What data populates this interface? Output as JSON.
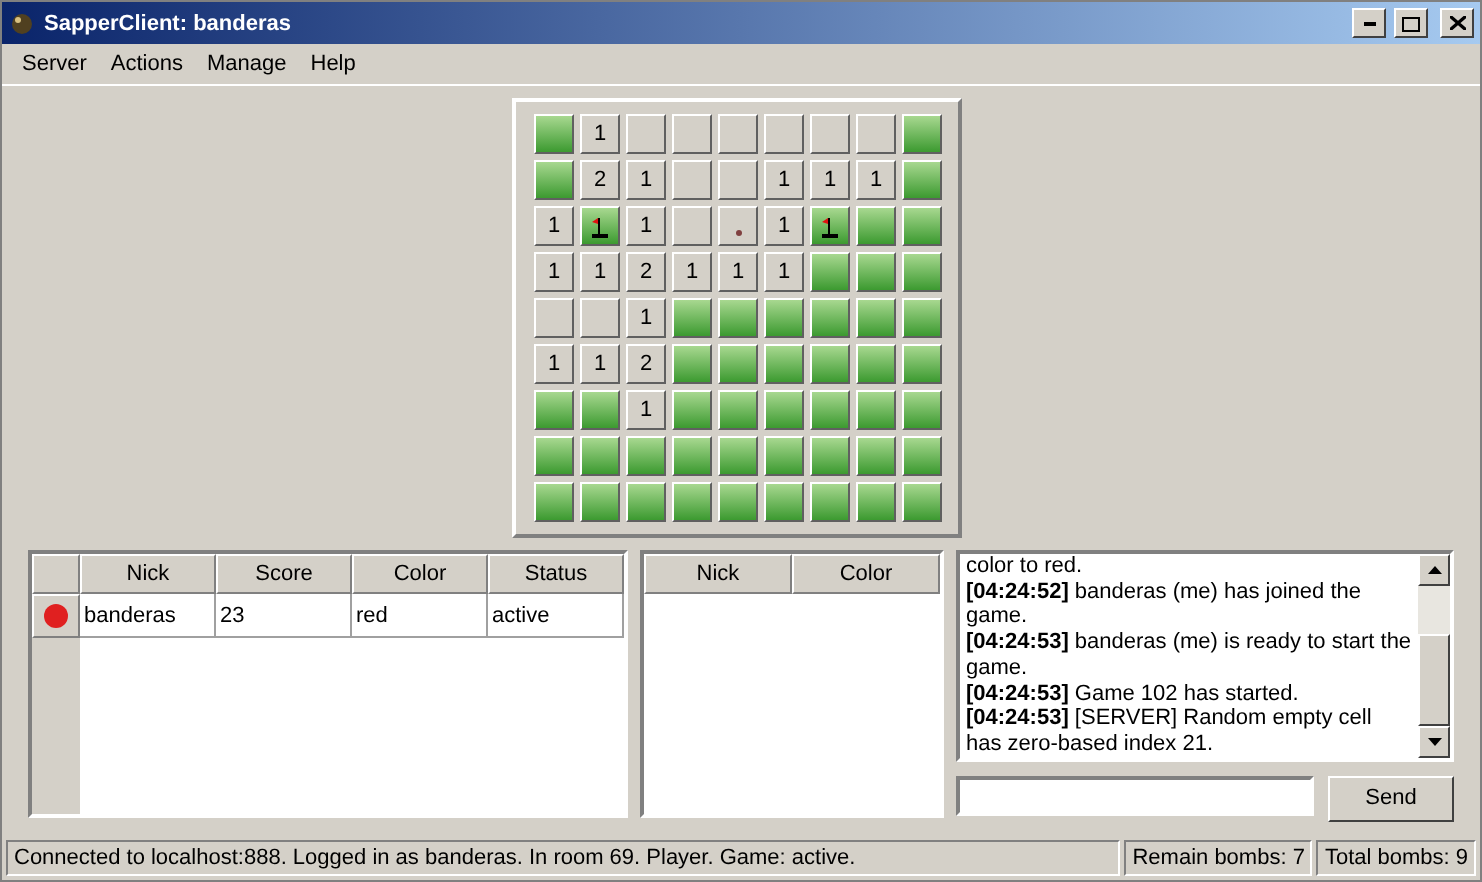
{
  "window": {
    "title": "SapperClient: banderas"
  },
  "menu": [
    "Server",
    "Actions",
    "Manage",
    "Help"
  ],
  "board": [
    [
      {
        "kind": "closed"
      },
      {
        "kind": "open",
        "text": "1"
      },
      {
        "kind": "open"
      },
      {
        "kind": "open"
      },
      {
        "kind": "open"
      },
      {
        "kind": "open"
      },
      {
        "kind": "open"
      },
      {
        "kind": "open"
      },
      {
        "kind": "closed"
      }
    ],
    [
      {
        "kind": "closed"
      },
      {
        "kind": "open",
        "text": "2"
      },
      {
        "kind": "open",
        "text": "1"
      },
      {
        "kind": "open"
      },
      {
        "kind": "open"
      },
      {
        "kind": "open",
        "text": "1"
      },
      {
        "kind": "open",
        "text": "1"
      },
      {
        "kind": "open",
        "text": "1"
      },
      {
        "kind": "closed"
      }
    ],
    [
      {
        "kind": "open",
        "text": "1"
      },
      {
        "kind": "flag"
      },
      {
        "kind": "open",
        "text": "1"
      },
      {
        "kind": "open"
      },
      {
        "kind": "dot"
      },
      {
        "kind": "open",
        "text": "1"
      },
      {
        "kind": "flag"
      },
      {
        "kind": "closed"
      },
      {
        "kind": "closed"
      }
    ],
    [
      {
        "kind": "open",
        "text": "1"
      },
      {
        "kind": "open",
        "text": "1"
      },
      {
        "kind": "open",
        "text": "2"
      },
      {
        "kind": "open",
        "text": "1"
      },
      {
        "kind": "open",
        "text": "1"
      },
      {
        "kind": "open",
        "text": "1"
      },
      {
        "kind": "closed"
      },
      {
        "kind": "closed"
      },
      {
        "kind": "closed"
      }
    ],
    [
      {
        "kind": "open"
      },
      {
        "kind": "open"
      },
      {
        "kind": "open",
        "text": "1"
      },
      {
        "kind": "closed"
      },
      {
        "kind": "closed"
      },
      {
        "kind": "closed"
      },
      {
        "kind": "closed"
      },
      {
        "kind": "closed"
      },
      {
        "kind": "closed"
      }
    ],
    [
      {
        "kind": "open",
        "text": "1"
      },
      {
        "kind": "open",
        "text": "1"
      },
      {
        "kind": "open",
        "text": "2"
      },
      {
        "kind": "closed"
      },
      {
        "kind": "closed"
      },
      {
        "kind": "closed"
      },
      {
        "kind": "closed"
      },
      {
        "kind": "closed"
      },
      {
        "kind": "closed"
      }
    ],
    [
      {
        "kind": "closed"
      },
      {
        "kind": "closed"
      },
      {
        "kind": "open",
        "text": "1"
      },
      {
        "kind": "closed"
      },
      {
        "kind": "closed"
      },
      {
        "kind": "closed"
      },
      {
        "kind": "closed"
      },
      {
        "kind": "closed"
      },
      {
        "kind": "closed"
      }
    ],
    [
      {
        "kind": "closed"
      },
      {
        "kind": "closed"
      },
      {
        "kind": "closed"
      },
      {
        "kind": "closed"
      },
      {
        "kind": "closed"
      },
      {
        "kind": "closed"
      },
      {
        "kind": "closed"
      },
      {
        "kind": "closed"
      },
      {
        "kind": "closed"
      }
    ],
    [
      {
        "kind": "closed"
      },
      {
        "kind": "closed"
      },
      {
        "kind": "closed"
      },
      {
        "kind": "closed"
      },
      {
        "kind": "closed"
      },
      {
        "kind": "closed"
      },
      {
        "kind": "closed"
      },
      {
        "kind": "closed"
      },
      {
        "kind": "closed"
      }
    ]
  ],
  "players_table": {
    "columns": [
      "Nick",
      "Score",
      "Color",
      "Status"
    ],
    "rows": [
      {
        "color": "#e02020",
        "cells": [
          "banderas",
          "23",
          "red",
          "active"
        ]
      }
    ]
  },
  "spectators_table": {
    "columns": [
      "Nick",
      "Color"
    ]
  },
  "chat": [
    {
      "text": "color to red."
    },
    {
      "time": "[04:24:52]",
      "text": "banderas (me) has joined the game."
    },
    {
      "time": "[04:24:53]",
      "text": "banderas (me) is ready to start the game."
    },
    {
      "time": "[04:24:53]",
      "text": "Game 102 has started."
    },
    {
      "time": "[04:24:53]",
      "text": "[SERVER] Random empty cell has zero-based index 21."
    }
  ],
  "send_button": "Send",
  "status_bar": [
    "Connected to localhost:888. Logged in as banderas. In room 69. Player. Game: active.",
    "Remain bombs: 7",
    "Total bombs: 9"
  ]
}
